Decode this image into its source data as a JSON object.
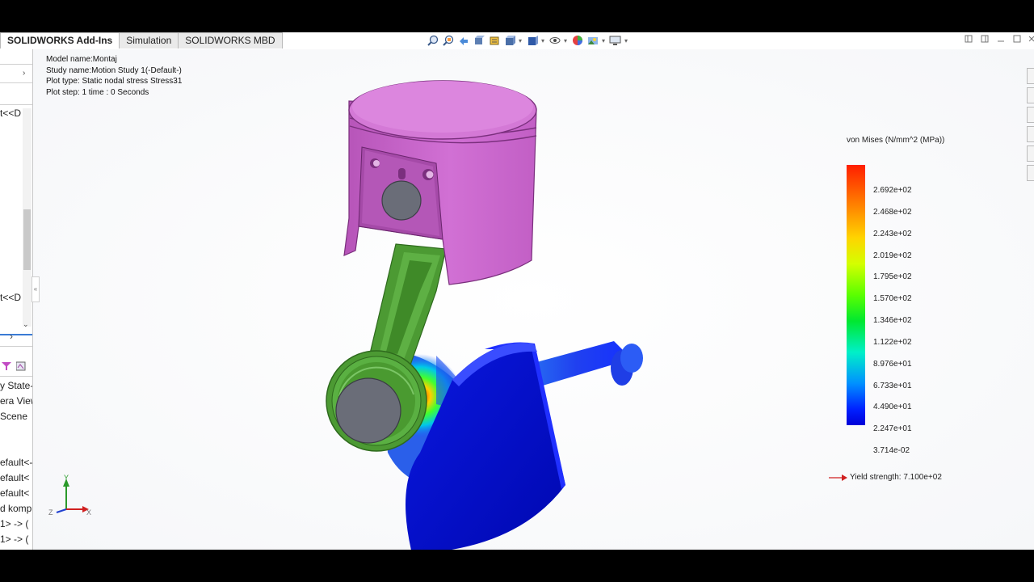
{
  "tabs": [
    {
      "label": "SOLIDWORKS Add-Ins",
      "active": true
    },
    {
      "label": "Simulation",
      "active": false
    },
    {
      "label": "SOLIDWORKS MBD",
      "active": false
    }
  ],
  "hud_icons": [
    "zoom-to-fit-icon",
    "zoom-to-area-icon",
    "previous-view-icon",
    "section-view-icon",
    "dynamic-annotation-icon",
    "view-orientation-icon",
    "display-style-icon",
    "hide-show-items-icon",
    "edit-appearance-icon",
    "apply-scene-icon",
    "view-settings-icon"
  ],
  "info": {
    "model_name": "Model name:Montaj",
    "study_name": "Study name:Motion Study 1(-Default-)",
    "plot_type": "Plot type: Static nodal stress Stress31",
    "plot_step": "Plot step: 1   time : 0 Seconds"
  },
  "left_panel": {
    "row1": "t<<D",
    "row2": "t<<D",
    "tree_items": [
      "y State-",
      "era View",
      "Scene",
      "efault<-",
      "efault<",
      "efault<",
      "d komp",
      "1> -> (",
      "1> -> ("
    ]
  },
  "legend": {
    "title": "von Mises (N/mm^2 (MPa))",
    "ticks": [
      "2.692e+02",
      "2.468e+02",
      "2.243e+02",
      "2.019e+02",
      "1.795e+02",
      "1.570e+02",
      "1.346e+02",
      "1.122e+02",
      "8.976e+01",
      "6.733e+01",
      "4.490e+01",
      "2.247e+01",
      "3.714e-02"
    ],
    "yield_label": "Yield strength: 7.100e+02"
  },
  "triad": {
    "x": "X",
    "y": "Y",
    "z": "Z"
  },
  "colors": {
    "piston": "#cc6ccf",
    "rod": "#4c9a33",
    "crank": "#0a12c8",
    "background": "#ffffff"
  }
}
